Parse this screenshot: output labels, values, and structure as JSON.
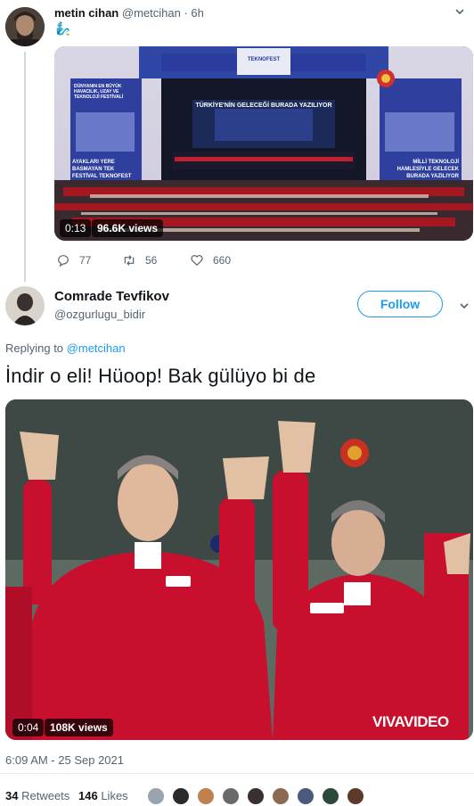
{
  "tweet1": {
    "display_name": "metin cihan",
    "handle": "@metcihan",
    "separator": "·",
    "time": "6h",
    "emoji": "🧞‍♂️",
    "video": {
      "duration": "0:13",
      "views": "96.6K views"
    },
    "stage": {
      "top_sign": "TEKNOFEST",
      "screen_text": "TÜRKİYE'NİN GELECEĞİ BURADA YAZILIYOR",
      "left_panel": "DÜNYANIN EN BÜYÜK HAVACILIK, UZAY VE TEKNOLOJİ FESTİVALİ",
      "left_bottom": "AYAKLARI YERE BASMAYAN TEK FESTİVAL TEKNOFEST",
      "right_bottom": "MİLLİ TEKNOLOJİ HAMLESİYLE GELECEK BURADA YAZILIYOR"
    },
    "stats": {
      "replies": "77",
      "retweets": "56",
      "likes": "660"
    }
  },
  "tweet2": {
    "display_name": "Comrade Tevfikov",
    "handle": "@ozgurlugu_bidir",
    "follow_label": "Follow",
    "replying_prefix": "Replying to",
    "replying_to": "@metcihan",
    "text": "İndir o eli! Hüoop! Bak gülüyo bi de",
    "video": {
      "duration": "0:04",
      "views": "108K views",
      "watermark": "VIVAVIDEO"
    },
    "timestamp": "6:09 AM - 25 Sep 2021",
    "retweets_count": "34",
    "retweets_label": "Retweets",
    "likes_count": "146",
    "likes_label": "Likes"
  },
  "colors": {
    "accent": "#1d9bf0",
    "jacket_red": "#c8102e",
    "stage_blue": "#2a3c9e",
    "crowd_red": "#b01820"
  }
}
